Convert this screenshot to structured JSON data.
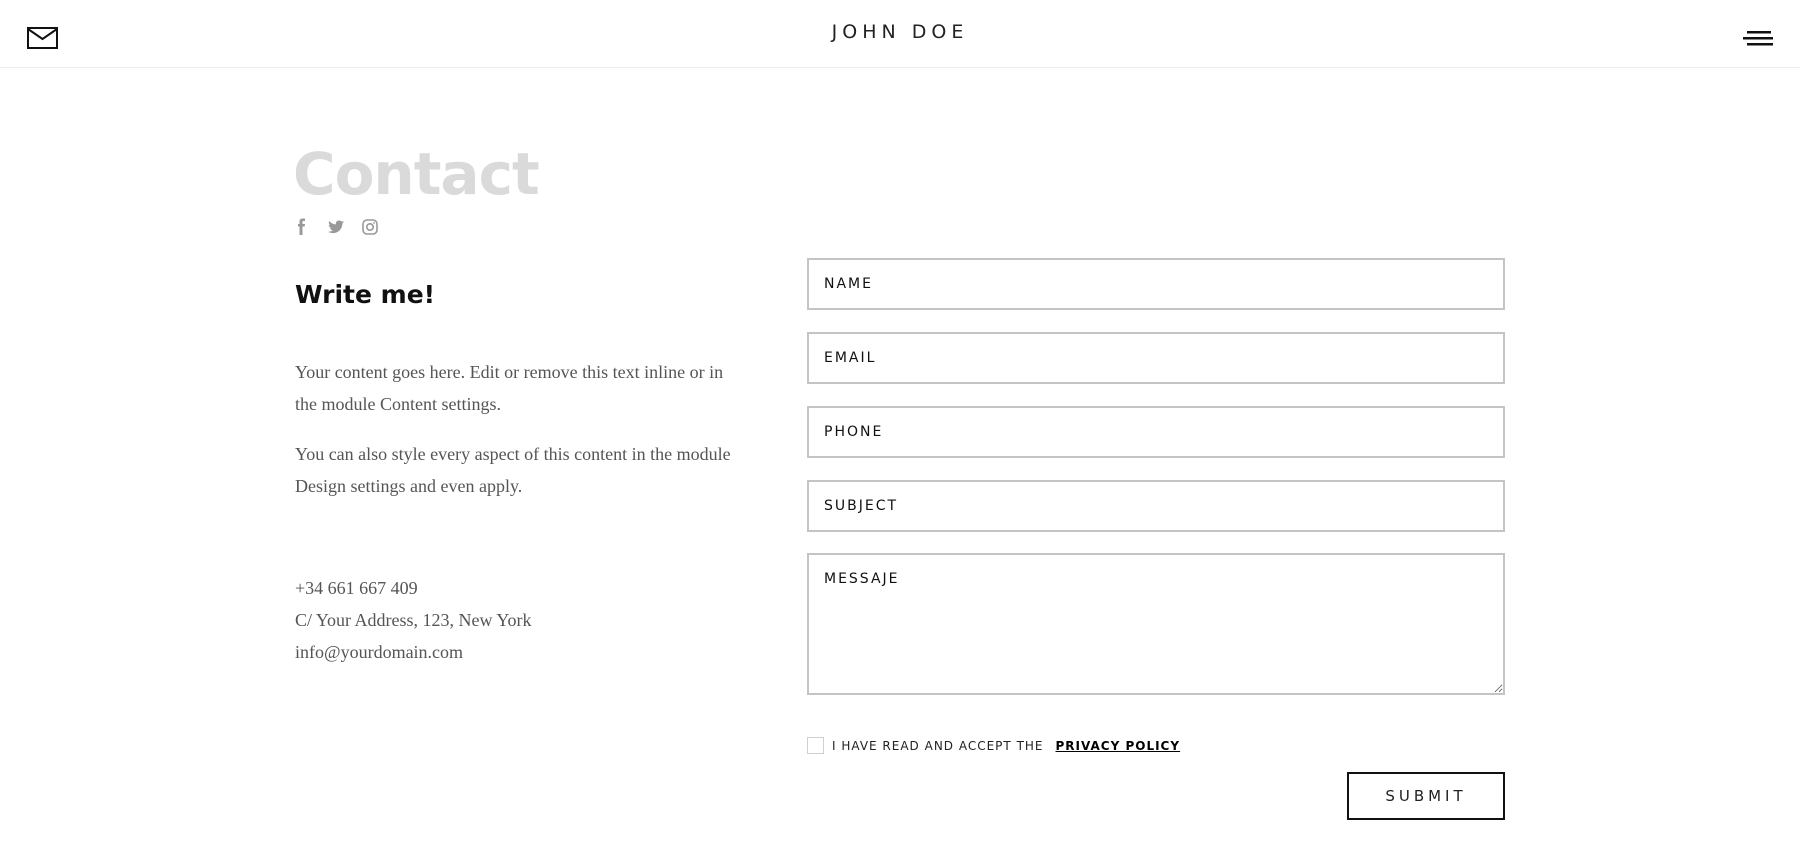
{
  "header": {
    "title": "JOHN DOE",
    "mail_icon": "envelope-icon",
    "menu_icon": "hamburger-menu-icon"
  },
  "main": {
    "title": "Contact",
    "social_icons": [
      "facebook-icon",
      "twitter-icon",
      "instagram-icon"
    ],
    "write_title": "Write me!",
    "paragraph1": "Your content goes here. Edit or remove this text inline or in the module Content settings.",
    "paragraph2": "You can also style every aspect of this content in the module Design settings and even apply.",
    "phone": "+34 661 667 409",
    "address": "C/ Your Address, 123, New York",
    "email": "info@yourdomain.com"
  },
  "form": {
    "name_placeholder": "NAME",
    "email_placeholder": "EMAIL",
    "phone_placeholder": "PHONE",
    "subject_placeholder": "SUBJECT",
    "message_placeholder": "MESSAJE",
    "consent_text": "I HAVE READ AND ACCEPT THE",
    "privacy_link": "PRIVACY POLICY",
    "submit_label": "SUBMIT"
  },
  "colors": {
    "title_gray": "#dadada",
    "border_gray": "#c4c4c4",
    "text_dark": "#111111",
    "body_text": "#555555"
  }
}
